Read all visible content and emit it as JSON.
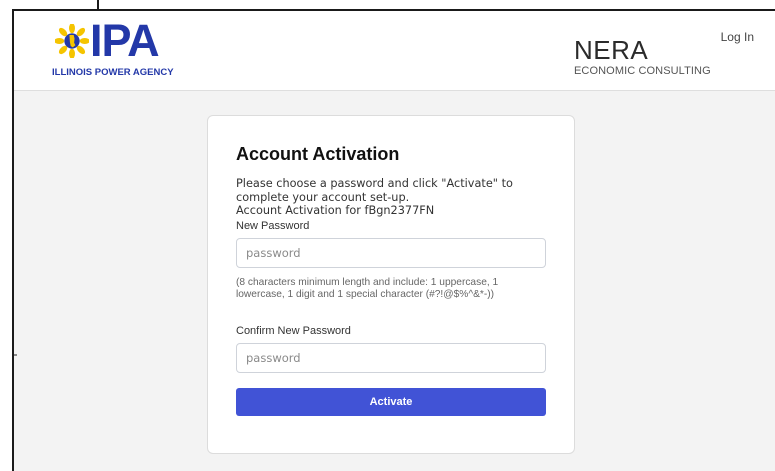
{
  "header": {
    "ipa_logo": {
      "wordmark": "IPA",
      "tagline": "ILLINOIS POWER AGENCY"
    },
    "nera_logo": {
      "wordmark": "NERA",
      "tagline": "ECONOMIC CONSULTING"
    },
    "login_label": "Log In"
  },
  "card": {
    "title": "Account Activation",
    "instructions": "Please choose a password and click \"Activate\" to complete your account set-up.",
    "activation_for": "Account Activation for fBgn2377FN",
    "new_password": {
      "label": "New Password",
      "placeholder": "password",
      "value": ""
    },
    "password_hint": "(8 characters minimum length and include: 1 uppercase, 1 lowercase, 1 digit and 1 special character (#?!@$%^&*-))",
    "confirm_password": {
      "label": "Confirm New Password",
      "placeholder": "password",
      "value": ""
    },
    "activate_label": "Activate"
  },
  "colors": {
    "brand_blue": "#2338a8",
    "button_blue": "#4153d6",
    "sunflower_yellow": "#f5c400",
    "page_background": "#f3f3f3"
  }
}
